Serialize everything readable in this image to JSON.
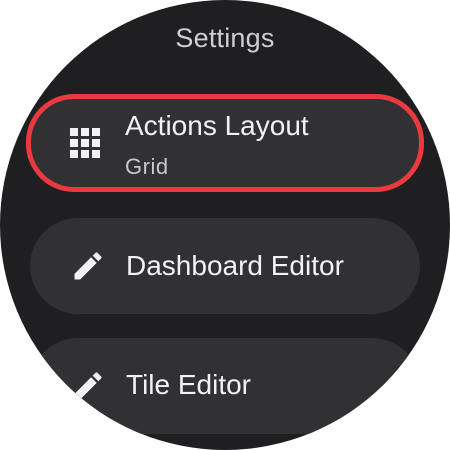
{
  "screen": {
    "title": "Settings"
  },
  "items": [
    {
      "label": "Actions Layout",
      "secondary": "Grid",
      "icon": "grid-icon",
      "selected": true
    },
    {
      "label": "Dashboard Editor",
      "icon": "pencil-icon"
    },
    {
      "label": "Tile Editor",
      "icon": "pencil-icon"
    }
  ],
  "colors": {
    "background": "#1f1f21",
    "chip": "#313133",
    "focus_ring": "#ea3a40",
    "text": "#f2f2f4",
    "secondary_text": "#c8c8cc",
    "title_text": "#cfcfd2"
  }
}
